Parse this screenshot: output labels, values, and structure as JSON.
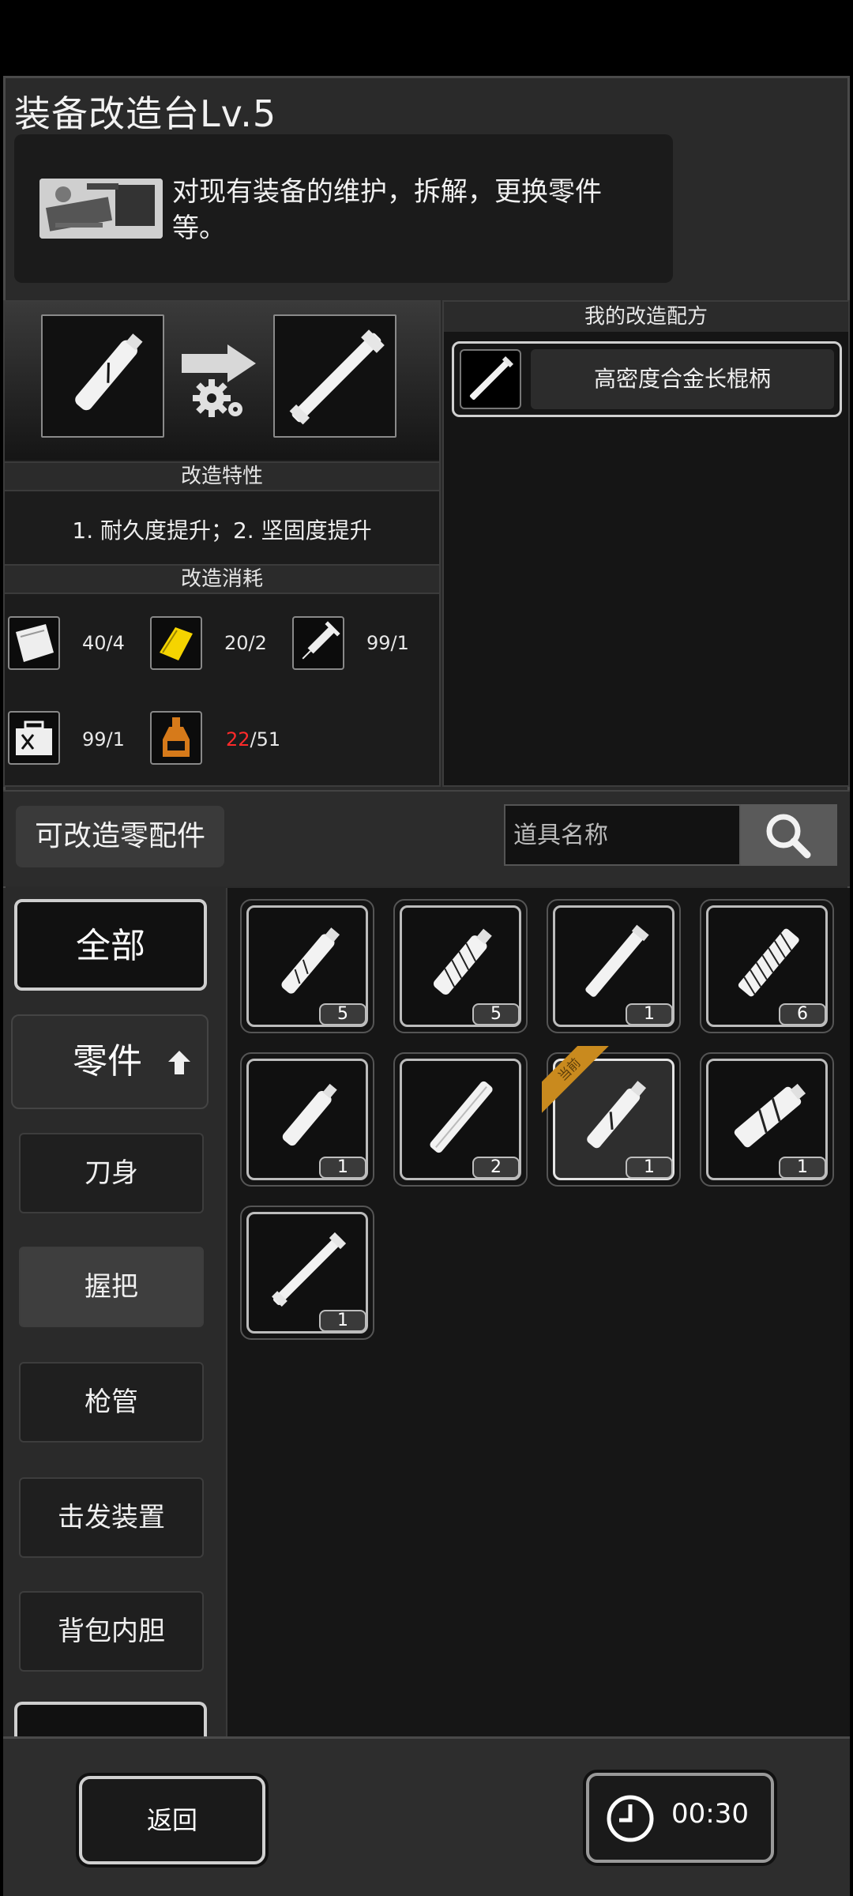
{
  "header": {
    "title": "装备改造台Lv.5",
    "description": "对现有装备的维护，拆解，更换零件等。"
  },
  "craft": {
    "traits_title": "改造特性",
    "traits_text": "1. 耐久度提升；2. 坚固度提升",
    "cost_title": "改造消耗",
    "costs": [
      {
        "icon": "cloth-icon",
        "value": "40/4"
      },
      {
        "icon": "gold-bar-icon",
        "value": "20/2"
      },
      {
        "icon": "syringe-icon",
        "value": "99/1"
      },
      {
        "icon": "toolbox-icon",
        "value": "99/1"
      },
      {
        "icon": "bottle-icon",
        "have": "22",
        "need": "/51",
        "have_color": "#ff2a2a"
      }
    ]
  },
  "recipes": {
    "title": "我的改造配方",
    "items": [
      {
        "label": "高密度合金长棍柄"
      }
    ]
  },
  "parts": {
    "title": "可改造零配件",
    "search_placeholder": "道具名称"
  },
  "categories": {
    "all": "全部",
    "parts": "零件",
    "items": [
      "刀身",
      "握把",
      "枪管",
      "击发装置",
      "背包内胆"
    ],
    "selected": "握把"
  },
  "grid": {
    "items": [
      {
        "count": "5"
      },
      {
        "count": "5"
      },
      {
        "count": "1"
      },
      {
        "count": "6"
      },
      {
        "count": "1"
      },
      {
        "count": "2"
      },
      {
        "count": "1",
        "badge": "当前"
      },
      {
        "count": "1"
      },
      {
        "count": "1"
      }
    ]
  },
  "footer": {
    "back_label": "返回",
    "timer": "00:30"
  },
  "colors": {
    "accent_ribbon": "#c98a1e",
    "insufficient": "#ff2a2a"
  }
}
